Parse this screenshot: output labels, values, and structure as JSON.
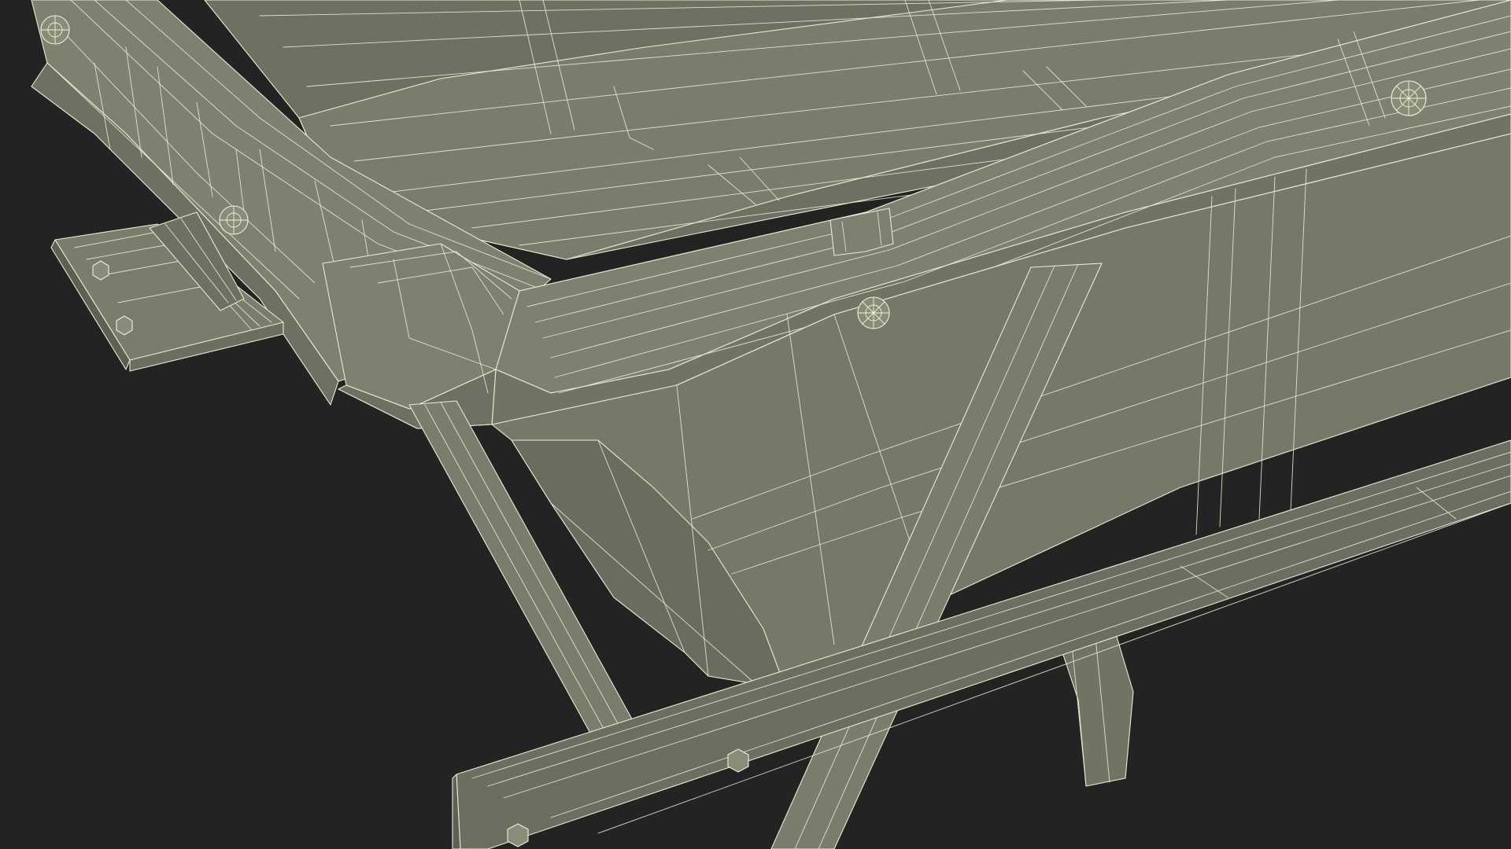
{
  "scene": {
    "subject": "wireframe-3d-model",
    "background_color": "#232323",
    "wire_color": "#e7ecd4",
    "surface_colors": {
      "top_face": "#7f8170",
      "top_face_dark": "#6e7161",
      "side_face": "#767967",
      "shadow_face": "#5e6152",
      "base_rail": "#6c6e5f",
      "bolt": "#8a8c78"
    }
  }
}
